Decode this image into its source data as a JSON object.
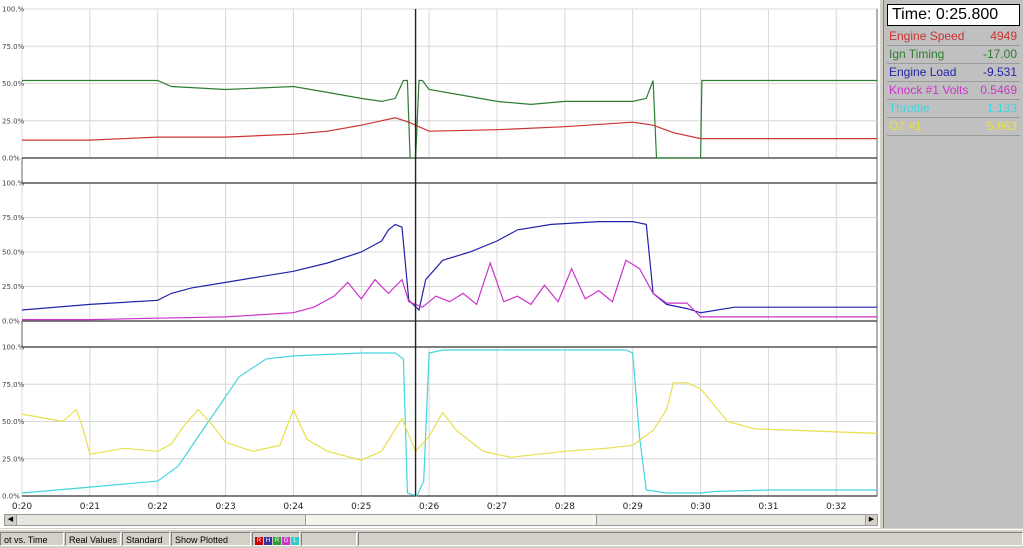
{
  "readout": {
    "time": "Time: 0:25.800",
    "channels": [
      {
        "name": "Engine Speed",
        "value": "4949",
        "color": "#cc3333"
      },
      {
        "name": "Ign Timing",
        "value": "-17.00",
        "color": "#2e7d32"
      },
      {
        "name": "Engine Load",
        "value": "-9.531",
        "color": "#2222aa"
      },
      {
        "name": "Knock #1 Volts",
        "value": "0.5469",
        "color": "#cc33cc"
      },
      {
        "name": "Throttle",
        "value": "1.133",
        "color": "#44d4e0"
      },
      {
        "name": "O2 #1",
        "value": "5.863",
        "color": "#e8e04a"
      }
    ]
  },
  "status_bar": {
    "mode": "ot vs. Time",
    "values": "Real Values",
    "view": "Standard",
    "plotted": "Show Plotted"
  },
  "legend_squares": [
    {
      "letter": "R",
      "color": "#cc0000"
    },
    {
      "letter": "H",
      "color": "#333399"
    },
    {
      "letter": "R",
      "color": "#339933"
    },
    {
      "letter": "G",
      "color": "#cc33cc"
    },
    {
      "letter": "L",
      "color": "#33cccc"
    }
  ],
  "chart_data": {
    "type": "line",
    "x_ticks": [
      "0:20",
      "0:21",
      "0:22",
      "0:23",
      "0:24",
      "0:25",
      "0:26",
      "0:27",
      "0:28",
      "0:29",
      "0:30",
      "0:31",
      "0:32"
    ],
    "y_ticks": [
      "0.0%",
      "25.0%",
      "50.0%",
      "75.0%",
      "100.%"
    ],
    "xlim": [
      20,
      32.6
    ],
    "ylim": [
      0,
      100
    ],
    "cursor_x": 25.8,
    "panels": [
      {
        "series": [
          {
            "name": "Ign Timing",
            "color": "#2e7d32",
            "points": [
              [
                20,
                52
              ],
              [
                22,
                52
              ],
              [
                22.2,
                48
              ],
              [
                23,
                46
              ],
              [
                24,
                48
              ],
              [
                24.5,
                44
              ],
              [
                25,
                40
              ],
              [
                25.3,
                38
              ],
              [
                25.5,
                40
              ],
              [
                25.62,
                52
              ],
              [
                25.68,
                52
              ],
              [
                25.72,
                0
              ],
              [
                25.8,
                0
              ],
              [
                25.85,
                52
              ],
              [
                25.9,
                52
              ],
              [
                26,
                46
              ],
              [
                26.5,
                42
              ],
              [
                27,
                38
              ],
              [
                27.5,
                36
              ],
              [
                28,
                38
              ],
              [
                28.5,
                38
              ],
              [
                29,
                38
              ],
              [
                29.2,
                40
              ],
              [
                29.3,
                52
              ],
              [
                29.35,
                0
              ],
              [
                30,
                0
              ],
              [
                30.02,
                52
              ],
              [
                32.6,
                52
              ]
            ]
          },
          {
            "name": "Engine Speed",
            "color": "#cc3333",
            "points": [
              [
                20,
                12
              ],
              [
                21,
                12
              ],
              [
                22,
                14
              ],
              [
                23,
                14
              ],
              [
                24,
                16
              ],
              [
                24.5,
                18
              ],
              [
                25,
                22
              ],
              [
                25.5,
                27
              ],
              [
                25.7,
                24
              ],
              [
                26,
                18
              ],
              [
                27,
                19
              ],
              [
                28,
                21
              ],
              [
                29,
                24
              ],
              [
                29.3,
                22
              ],
              [
                29.6,
                17
              ],
              [
                30,
                13
              ],
              [
                32.6,
                13
              ]
            ]
          }
        ]
      },
      {
        "series": [
          {
            "name": "Engine Load",
            "color": "#2222aa",
            "points": [
              [
                20,
                8
              ],
              [
                21,
                12
              ],
              [
                22,
                15
              ],
              [
                22.2,
                20
              ],
              [
                22.5,
                24
              ],
              [
                23,
                28
              ],
              [
                23.5,
                32
              ],
              [
                24,
                36
              ],
              [
                24.5,
                42
              ],
              [
                25,
                50
              ],
              [
                25.3,
                58
              ],
              [
                25.4,
                66
              ],
              [
                25.5,
                70
              ],
              [
                25.6,
                68
              ],
              [
                25.7,
                15
              ],
              [
                25.85,
                8
              ],
              [
                25.95,
                30
              ],
              [
                26.2,
                44
              ],
              [
                26.6,
                50
              ],
              [
                27,
                58
              ],
              [
                27.3,
                66
              ],
              [
                27.8,
                70
              ],
              [
                28.5,
                72
              ],
              [
                29,
                72
              ],
              [
                29.2,
                70
              ],
              [
                29.3,
                20
              ],
              [
                29.5,
                12
              ],
              [
                29.8,
                9
              ],
              [
                30,
                6
              ],
              [
                30.5,
                10
              ],
              [
                32.6,
                10
              ]
            ]
          },
          {
            "name": "Knock #1 Volts",
            "color": "#cc33cc",
            "points": [
              [
                20,
                1
              ],
              [
                21,
                1
              ],
              [
                22,
                2
              ],
              [
                23,
                3
              ],
              [
                24,
                6
              ],
              [
                24.3,
                10
              ],
              [
                24.6,
                18
              ],
              [
                24.8,
                28
              ],
              [
                25,
                16
              ],
              [
                25.2,
                30
              ],
              [
                25.4,
                20
              ],
              [
                25.6,
                30
              ],
              [
                25.7,
                14
              ],
              [
                25.9,
                10
              ],
              [
                26.1,
                18
              ],
              [
                26.3,
                14
              ],
              [
                26.5,
                20
              ],
              [
                26.7,
                12
              ],
              [
                26.9,
                42
              ],
              [
                27.1,
                14
              ],
              [
                27.3,
                18
              ],
              [
                27.5,
                12
              ],
              [
                27.7,
                26
              ],
              [
                27.9,
                14
              ],
              [
                28.1,
                38
              ],
              [
                28.3,
                16
              ],
              [
                28.5,
                22
              ],
              [
                28.7,
                14
              ],
              [
                28.9,
                44
              ],
              [
                29.1,
                38
              ],
              [
                29.3,
                20
              ],
              [
                29.5,
                13
              ],
              [
                29.8,
                13
              ],
              [
                30,
                3
              ],
              [
                32.6,
                3
              ]
            ]
          }
        ]
      },
      {
        "series": [
          {
            "name": "Throttle",
            "color": "#44d4e0",
            "points": [
              [
                20,
                2
              ],
              [
                21,
                6
              ],
              [
                22,
                10
              ],
              [
                22.3,
                20
              ],
              [
                22.6,
                40
              ],
              [
                22.9,
                60
              ],
              [
                23.2,
                80
              ],
              [
                23.6,
                92
              ],
              [
                24,
                94
              ],
              [
                25,
                96
              ],
              [
                25.5,
                96
              ],
              [
                25.62,
                92
              ],
              [
                25.68,
                2
              ],
              [
                25.82,
                0
              ],
              [
                25.92,
                10
              ],
              [
                26,
                96
              ],
              [
                26.2,
                98
              ],
              [
                27,
                98
              ],
              [
                28,
                98
              ],
              [
                28.9,
                98
              ],
              [
                29,
                96
              ],
              [
                29.1,
                40
              ],
              [
                29.2,
                4
              ],
              [
                29.5,
                2
              ],
              [
                30,
                2
              ],
              [
                30.2,
                3
              ],
              [
                31,
                4
              ],
              [
                32,
                4
              ],
              [
                32.6,
                4
              ]
            ]
          },
          {
            "name": "O2 #1",
            "color": "#e8e04a",
            "points": [
              [
                20,
                55
              ],
              [
                20.6,
                50
              ],
              [
                20.8,
                58
              ],
              [
                20.9,
                45
              ],
              [
                21,
                28
              ],
              [
                21.5,
                32
              ],
              [
                22,
                30
              ],
              [
                22.2,
                35
              ],
              [
                22.4,
                48
              ],
              [
                22.6,
                58
              ],
              [
                22.8,
                48
              ],
              [
                23,
                36
              ],
              [
                23.4,
                30
              ],
              [
                23.8,
                34
              ],
              [
                24,
                58
              ],
              [
                24.2,
                38
              ],
              [
                24.5,
                30
              ],
              [
                25,
                24
              ],
              [
                25.3,
                30
              ],
              [
                25.6,
                52
              ],
              [
                25.8,
                30
              ],
              [
                26,
                40
              ],
              [
                26.2,
                56
              ],
              [
                26.4,
                44
              ],
              [
                26.8,
                30
              ],
              [
                27.2,
                26
              ],
              [
                28,
                30
              ],
              [
                28.6,
                32
              ],
              [
                29,
                34
              ],
              [
                29.3,
                44
              ],
              [
                29.5,
                58
              ],
              [
                29.6,
                76
              ],
              [
                29.8,
                76
              ],
              [
                30,
                72
              ],
              [
                30.4,
                50
              ],
              [
                30.8,
                45
              ],
              [
                32.6,
                42
              ]
            ]
          }
        ]
      }
    ]
  }
}
